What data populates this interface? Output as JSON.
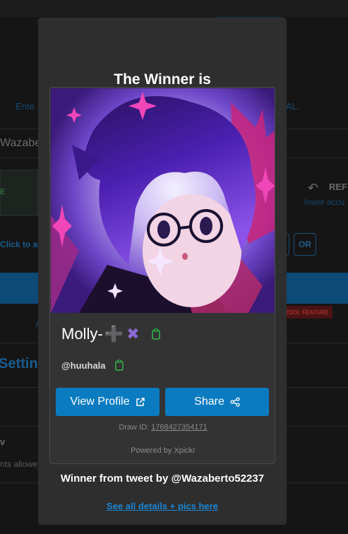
{
  "background": {
    "enter_text": "Ente",
    "al_text": "AL.",
    "username_fragment": "Wazabe",
    "e_fragment": "E",
    "ref_label": "REF",
    "lower_accounts": "lower accu",
    "click_to_add": "Click to a",
    "or_label": "OR",
    "a_fragment": "A",
    "tool_feature": "TOOL FEATURE",
    "settings_fragment": "Setting",
    "v_fragment": "v",
    "nts_allowed": "nts allowe"
  },
  "modal": {
    "title": "The Winner is",
    "winner": {
      "name": "Molly-",
      "name_emoji": "➕✖",
      "handle": "@huuhala"
    },
    "buttons": {
      "view_profile": "View Profile",
      "share": "Share"
    },
    "draw_id_label": "Draw ID:",
    "draw_id_value": "1768427354171",
    "powered_by": "Powered by Xpickr",
    "tweet_line": "Winner from tweet by @Wazaberto52237",
    "details_link": "See all details + pics here"
  },
  "colors": {
    "accent": "#0a7bc0",
    "copy_icon": "#2fb84a",
    "link": "#1b86d6"
  },
  "icons": [
    "copy-icon",
    "external-link-icon",
    "share-icon",
    "undo-arrow-icon"
  ]
}
